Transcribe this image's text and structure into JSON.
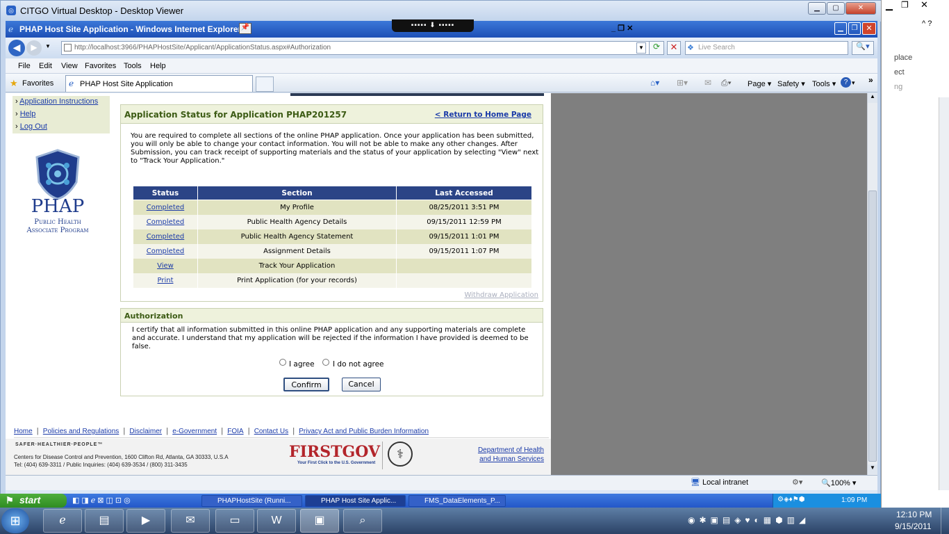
{
  "outer_window": {
    "title": "CITGO Virtual Desktop - Desktop Viewer"
  },
  "ie": {
    "title": "PHAP Host Site Application - Windows Internet Explorer",
    "address": "http://localhost:3966/PHAPHostSite/Applicant/ApplicationStatus.aspx#Authorization",
    "address_display": "http://localhost:3966/PHAPHostSite/Applicant/ApplicationStatus.aspx#Authorization",
    "search_placeholder": "Live Search",
    "menu": [
      "File",
      "Edit",
      "View",
      "Favorites",
      "Tools",
      "Help"
    ],
    "favorites_label": "Favorites",
    "tab_label": "PHAP Host Site Application",
    "cmd": {
      "page": "Page",
      "safety": "Safety",
      "tools": "Tools"
    },
    "status_zone": "Local intranet",
    "zoom": "100%"
  },
  "left_nav": {
    "items": [
      "Application Instructions",
      "Help",
      "Log Out"
    ],
    "logo_title": "PHAP",
    "logo_sub1": "Public Health",
    "logo_sub2": "Associate Program"
  },
  "status_box": {
    "title": "Application Status for Application PHAP201257",
    "return_link": "< Return to Home Page",
    "intro": "You are required to complete all sections of the online PHAP application. Once your application has been submitted, you will only be able to change your contact information. You will not be able to make any other changes. After Submission, you can track receipt of supporting materials and the status of your application by selecting \"View\" next to \"Track Your Application.\"",
    "columns": [
      "Status",
      "Section",
      "Last Accessed"
    ],
    "rows": [
      {
        "status": "Completed",
        "section": "My Profile",
        "accessed": "08/25/2011 3:51 PM"
      },
      {
        "status": "Completed",
        "section": "Public Health Agency Details",
        "accessed": "09/15/2011 12:59 PM"
      },
      {
        "status": "Completed",
        "section": "Public Health Agency Statement",
        "accessed": "09/15/2011 1:01 PM"
      },
      {
        "status": "Completed",
        "section": "Assignment Details",
        "accessed": "09/15/2011 1:07 PM"
      },
      {
        "status": "View",
        "section": "Track Your Application",
        "accessed": ""
      },
      {
        "status": "Print",
        "section": "Print Application (for your records)",
        "accessed": ""
      }
    ],
    "withdraw": "Withdraw Application"
  },
  "auth_box": {
    "title": "Authorization",
    "text": "I certify that all information submitted in this online PHAP application and any supporting materials are complete and accurate.  I understand that my application will be rejected if the information I have provided is deemed to be false.",
    "agree": "I agree",
    "disagree": "I do not agree",
    "confirm": "Confirm",
    "cancel": "Cancel"
  },
  "footer": {
    "links": [
      "Home",
      "Policies and Regulations",
      "Disclaimer",
      "e-Government",
      "FOIA",
      "Contact Us",
      "Privacy Act and Public Burden Information"
    ],
    "tagline": "SAFER·HEALTHIER·PEOPLE™",
    "address1": "Centers for Disease Control and Prevention, 1600 Clifton Rd, Atlanta, GA 30333, U.S.A",
    "address2": "Tel: (404) 639-3311 / Public Inquiries: (404) 639-3534 / (800) 311-3435",
    "firstgov": "FIRSTGOV",
    "firstgov_sub": "Your First Click to the U.S. Government",
    "hhs1": "Department of Health",
    "hhs2": "and Human Services"
  },
  "xp_taskbar": {
    "start": "start",
    "tasks": [
      "PHAPHostSite (Runni...",
      "PHAP Host Site Applic...",
      "FMS_DataElements_P..."
    ],
    "clock": "1:09 PM"
  },
  "right_app": {
    "lines": [
      "place",
      "ect",
      "ng"
    ]
  },
  "win7_taskbar": {
    "time": "12:10 PM",
    "date": "9/15/2011"
  }
}
